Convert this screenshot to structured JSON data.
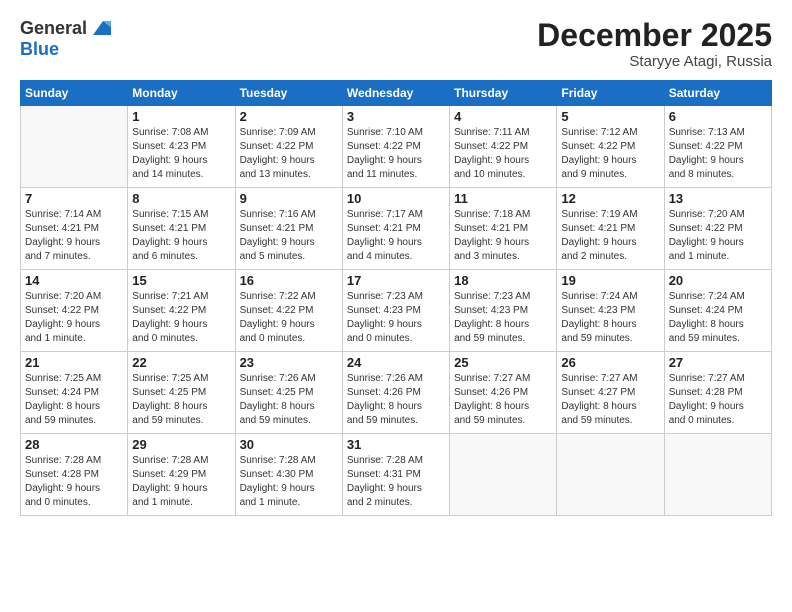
{
  "header": {
    "logo_line1": "General",
    "logo_line2": "Blue",
    "title": "December 2025",
    "location": "Staryye Atagi, Russia"
  },
  "weekdays": [
    "Sunday",
    "Monday",
    "Tuesday",
    "Wednesday",
    "Thursday",
    "Friday",
    "Saturday"
  ],
  "weeks": [
    [
      {
        "day": "",
        "info": ""
      },
      {
        "day": "1",
        "info": "Sunrise: 7:08 AM\nSunset: 4:23 PM\nDaylight: 9 hours\nand 14 minutes."
      },
      {
        "day": "2",
        "info": "Sunrise: 7:09 AM\nSunset: 4:22 PM\nDaylight: 9 hours\nand 13 minutes."
      },
      {
        "day": "3",
        "info": "Sunrise: 7:10 AM\nSunset: 4:22 PM\nDaylight: 9 hours\nand 11 minutes."
      },
      {
        "day": "4",
        "info": "Sunrise: 7:11 AM\nSunset: 4:22 PM\nDaylight: 9 hours\nand 10 minutes."
      },
      {
        "day": "5",
        "info": "Sunrise: 7:12 AM\nSunset: 4:22 PM\nDaylight: 9 hours\nand 9 minutes."
      },
      {
        "day": "6",
        "info": "Sunrise: 7:13 AM\nSunset: 4:22 PM\nDaylight: 9 hours\nand 8 minutes."
      }
    ],
    [
      {
        "day": "7",
        "info": "Sunrise: 7:14 AM\nSunset: 4:21 PM\nDaylight: 9 hours\nand 7 minutes."
      },
      {
        "day": "8",
        "info": "Sunrise: 7:15 AM\nSunset: 4:21 PM\nDaylight: 9 hours\nand 6 minutes."
      },
      {
        "day": "9",
        "info": "Sunrise: 7:16 AM\nSunset: 4:21 PM\nDaylight: 9 hours\nand 5 minutes."
      },
      {
        "day": "10",
        "info": "Sunrise: 7:17 AM\nSunset: 4:21 PM\nDaylight: 9 hours\nand 4 minutes."
      },
      {
        "day": "11",
        "info": "Sunrise: 7:18 AM\nSunset: 4:21 PM\nDaylight: 9 hours\nand 3 minutes."
      },
      {
        "day": "12",
        "info": "Sunrise: 7:19 AM\nSunset: 4:21 PM\nDaylight: 9 hours\nand 2 minutes."
      },
      {
        "day": "13",
        "info": "Sunrise: 7:20 AM\nSunset: 4:22 PM\nDaylight: 9 hours\nand 1 minute."
      }
    ],
    [
      {
        "day": "14",
        "info": "Sunrise: 7:20 AM\nSunset: 4:22 PM\nDaylight: 9 hours\nand 1 minute."
      },
      {
        "day": "15",
        "info": "Sunrise: 7:21 AM\nSunset: 4:22 PM\nDaylight: 9 hours\nand 0 minutes."
      },
      {
        "day": "16",
        "info": "Sunrise: 7:22 AM\nSunset: 4:22 PM\nDaylight: 9 hours\nand 0 minutes."
      },
      {
        "day": "17",
        "info": "Sunrise: 7:23 AM\nSunset: 4:23 PM\nDaylight: 9 hours\nand 0 minutes."
      },
      {
        "day": "18",
        "info": "Sunrise: 7:23 AM\nSunset: 4:23 PM\nDaylight: 8 hours\nand 59 minutes."
      },
      {
        "day": "19",
        "info": "Sunrise: 7:24 AM\nSunset: 4:23 PM\nDaylight: 8 hours\nand 59 minutes."
      },
      {
        "day": "20",
        "info": "Sunrise: 7:24 AM\nSunset: 4:24 PM\nDaylight: 8 hours\nand 59 minutes."
      }
    ],
    [
      {
        "day": "21",
        "info": "Sunrise: 7:25 AM\nSunset: 4:24 PM\nDaylight: 8 hours\nand 59 minutes."
      },
      {
        "day": "22",
        "info": "Sunrise: 7:25 AM\nSunset: 4:25 PM\nDaylight: 8 hours\nand 59 minutes."
      },
      {
        "day": "23",
        "info": "Sunrise: 7:26 AM\nSunset: 4:25 PM\nDaylight: 8 hours\nand 59 minutes."
      },
      {
        "day": "24",
        "info": "Sunrise: 7:26 AM\nSunset: 4:26 PM\nDaylight: 8 hours\nand 59 minutes."
      },
      {
        "day": "25",
        "info": "Sunrise: 7:27 AM\nSunset: 4:26 PM\nDaylight: 8 hours\nand 59 minutes."
      },
      {
        "day": "26",
        "info": "Sunrise: 7:27 AM\nSunset: 4:27 PM\nDaylight: 8 hours\nand 59 minutes."
      },
      {
        "day": "27",
        "info": "Sunrise: 7:27 AM\nSunset: 4:28 PM\nDaylight: 9 hours\nand 0 minutes."
      }
    ],
    [
      {
        "day": "28",
        "info": "Sunrise: 7:28 AM\nSunset: 4:28 PM\nDaylight: 9 hours\nand 0 minutes."
      },
      {
        "day": "29",
        "info": "Sunrise: 7:28 AM\nSunset: 4:29 PM\nDaylight: 9 hours\nand 1 minute."
      },
      {
        "day": "30",
        "info": "Sunrise: 7:28 AM\nSunset: 4:30 PM\nDaylight: 9 hours\nand 1 minute."
      },
      {
        "day": "31",
        "info": "Sunrise: 7:28 AM\nSunset: 4:31 PM\nDaylight: 9 hours\nand 2 minutes."
      },
      {
        "day": "",
        "info": ""
      },
      {
        "day": "",
        "info": ""
      },
      {
        "day": "",
        "info": ""
      }
    ]
  ]
}
